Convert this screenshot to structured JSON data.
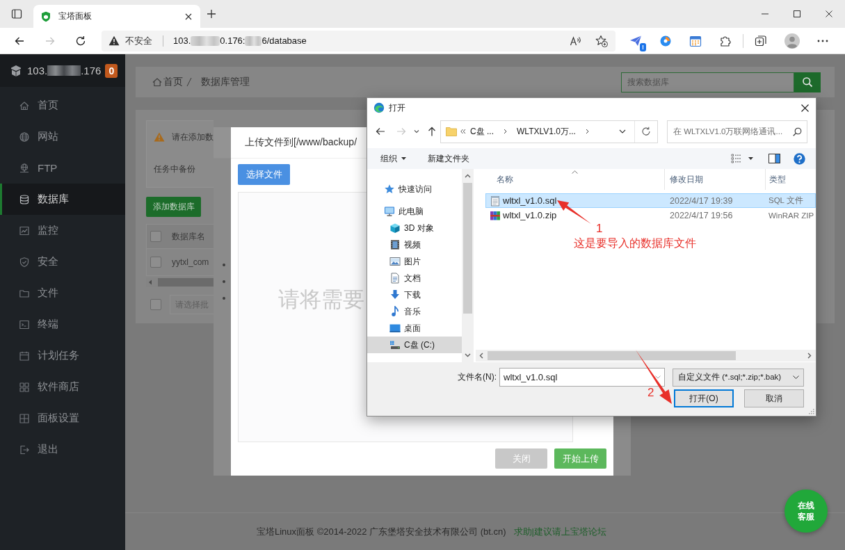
{
  "browser": {
    "tabs": [
      {
        "title": "宝塔面板",
        "selected": true
      }
    ],
    "address": {
      "security": "不安全",
      "url_parts": [
        "103.",
        "0.176:",
        "6/database"
      ]
    },
    "extension_badge": "!"
  },
  "sidebar": {
    "host_parts": [
      "103.",
      ".176"
    ],
    "badge": "0",
    "items": [
      {
        "label": "首页",
        "kind": "home",
        "selected": false
      },
      {
        "label": "网站",
        "kind": "globe",
        "selected": false
      },
      {
        "label": "FTP",
        "kind": "ftp",
        "selected": false
      },
      {
        "label": "数据库",
        "kind": "database",
        "selected": true
      },
      {
        "label": "监控",
        "kind": "monitor",
        "selected": false
      },
      {
        "label": "安全",
        "kind": "shield",
        "selected": false
      },
      {
        "label": "文件",
        "kind": "folder",
        "selected": false
      },
      {
        "label": "终端",
        "kind": "terminal",
        "selected": false
      },
      {
        "label": "计划任务",
        "kind": "calendar",
        "selected": false
      },
      {
        "label": "软件商店",
        "kind": "apps",
        "selected": false
      },
      {
        "label": "面板设置",
        "kind": "settings",
        "selected": false
      },
      {
        "label": "退出",
        "kind": "logout",
        "selected": false
      }
    ]
  },
  "breadcrumb": [
    "首页",
    "数据库管理"
  ],
  "search": {
    "placeholder": "搜索数据库"
  },
  "card": {
    "notice": "请在添加数",
    "backup_label": "任务中备份",
    "add_button": "添加数据库",
    "table": {
      "header_checked": false,
      "columns": [
        "数据库名"
      ],
      "rows": [
        {
          "name": "yytxl_com",
          "checked": false
        }
      ]
    },
    "batch": {
      "checked": false,
      "placeholder": "请选择批"
    }
  },
  "upload_dialog": {
    "title": "上传文件到[/www/backup/",
    "choose_button": "选择文件",
    "drop_hint": "请将需要",
    "buttons": [
      {
        "label": "关闭",
        "kind": "secondary"
      },
      {
        "label": "开始上传",
        "kind": "primary"
      }
    ]
  },
  "file_dialog": {
    "title": "打开",
    "path": [
      "C盘 ...",
      "WLTXLV1.0万..."
    ],
    "search_placeholder": "在 WLTXLV1.0万联网络通讯...",
    "toolbar": [
      {
        "label": "组织",
        "kind": "menu"
      },
      {
        "label": "新建文件夹",
        "kind": "button"
      }
    ],
    "nav": [
      {
        "label": "快速访问",
        "kind": "star",
        "selected": false
      },
      {
        "label": "此电脑",
        "kind": "pc",
        "selected": false,
        "children": [
          {
            "label": "3D 对象",
            "kind": "cube",
            "selected": false
          },
          {
            "label": "视频",
            "kind": "video",
            "selected": false
          },
          {
            "label": "图片",
            "kind": "picture",
            "selected": false
          },
          {
            "label": "文档",
            "kind": "document",
            "selected": false
          },
          {
            "label": "下载",
            "kind": "download",
            "selected": false
          },
          {
            "label": "音乐",
            "kind": "music",
            "selected": false
          },
          {
            "label": "桌面",
            "kind": "desktop",
            "selected": false
          },
          {
            "label": "C盘 (C:)",
            "kind": "drive",
            "selected": true
          }
        ]
      }
    ],
    "columns": [
      "名称",
      "修改日期",
      "类型"
    ],
    "files": [
      {
        "name": "wltxl_v1.0.sql",
        "modified": "2022/4/17 19:39",
        "type": "SQL 文件",
        "kind": "sql",
        "selected": true
      },
      {
        "name": "wltxl_v1.0.zip",
        "modified": "2022/4/17 19:56",
        "type": "WinRAR ZIP",
        "kind": "archive",
        "selected": false
      }
    ],
    "filename_label": "文件名(N):",
    "filename": "wltxl_v1.0.sql",
    "filter": "自定义文件 (*.sql;*.zip;*.bak)",
    "buttons": [
      {
        "label": "打开(O)",
        "kind": "default"
      },
      {
        "label": "取消",
        "kind": "normal"
      }
    ]
  },
  "annotations": [
    {
      "number": "1",
      "text": "这是要导入的数据库文件"
    },
    {
      "number": "2"
    }
  ],
  "footer": {
    "copyright": "宝塔Linux面板 ©2014-2022 广东堡塔安全技术有限公司 (bt.cn)",
    "link": "求助|建议请上宝塔论坛"
  },
  "chat_button": "在线客服"
}
